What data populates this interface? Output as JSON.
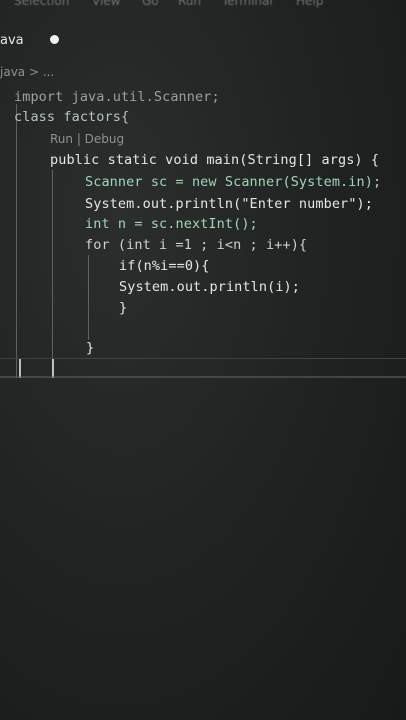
{
  "menubar": {
    "items": [
      "Selection",
      "View",
      "Go",
      "Run",
      "Terminal",
      "Help"
    ]
  },
  "editor": {
    "tab_label": "ava",
    "breadcrumb": "java > ...",
    "codelens": "Run | Debug",
    "lines": {
      "l1": "import java.util.Scanner;",
      "l2": "class factors{",
      "l3": "public static void main(String[] args) {",
      "l4": "Scanner sc = new Scanner(System.in);",
      "l5": "System.out.println(\"Enter number\");",
      "l6": "int n = sc.nextInt();",
      "l7": "for (int i =1 ; i<n ; i++){",
      "l8": "if(n%i==0){",
      "l9": "System.out.println(i);",
      "l10": "}",
      "l11": "}"
    }
  }
}
